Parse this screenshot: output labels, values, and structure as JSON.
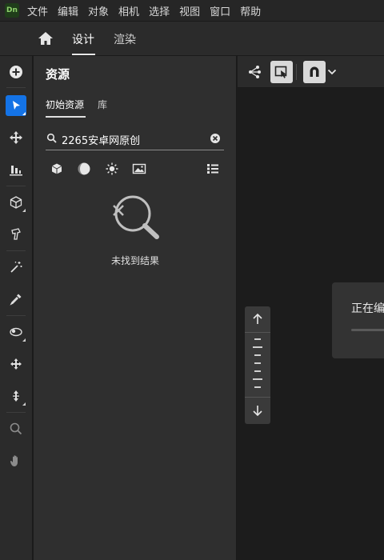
{
  "app": {
    "logo_text": "Dn"
  },
  "menu": [
    "文件",
    "编辑",
    "对象",
    "相机",
    "选择",
    "视图",
    "窗口",
    "帮助"
  ],
  "tabs": {
    "design": "设计",
    "render": "渲染",
    "active": "design"
  },
  "toolbar": {
    "tools": [
      {
        "name": "add-icon"
      },
      {
        "name": "select-icon",
        "active": true
      },
      {
        "name": "move-icon"
      },
      {
        "name": "align-to-ground-icon"
      },
      {
        "name": "primitive-cube-icon"
      },
      {
        "name": "model-icon"
      },
      {
        "name": "magic-wand-icon"
      },
      {
        "name": "eyedropper-icon"
      },
      {
        "name": "orbit-icon"
      },
      {
        "name": "pan-icon"
      },
      {
        "name": "dolly-icon"
      },
      {
        "name": "zoom-icon"
      },
      {
        "name": "hand-icon"
      }
    ]
  },
  "assets_panel": {
    "title": "资源",
    "subtabs": [
      "初始资源",
      "库"
    ],
    "active_subtab": 0,
    "search": {
      "value": "2265安卓网原创",
      "placeholder": ""
    },
    "filters": [
      "model-filter-icon",
      "material-filter-icon",
      "light-filter-icon",
      "image-filter-icon",
      "list-view-icon"
    ],
    "empty_text": "未找到结果"
  },
  "canvas": {
    "dialog_text": "正在编",
    "progress": 0.0
  },
  "colors": {
    "accent": "#1473e6",
    "panel": "#2f2f2f",
    "background": "#1c1c1c"
  }
}
